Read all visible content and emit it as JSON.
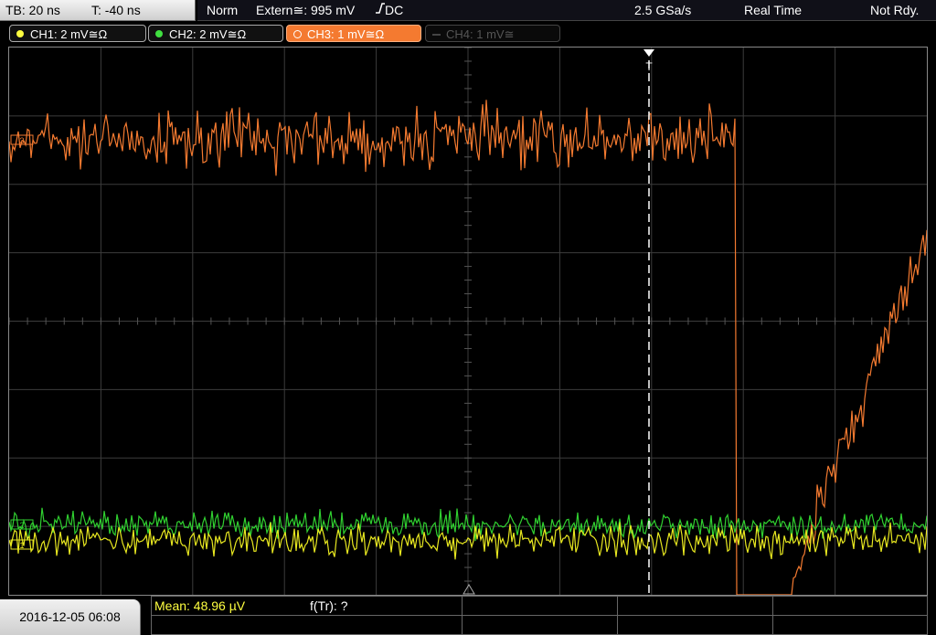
{
  "topbar": {
    "timebase": "TB: 20 ns",
    "trigger_time": "T: -40 ns",
    "mode": "Norm",
    "trigger_source": "Extern≅: 995 mV",
    "trigger_coupling": "DC",
    "sample_rate": "2.5 GSa/s",
    "acquisition": "Real Time",
    "status": "Not Rdy."
  },
  "channels": [
    {
      "label": "CH1: 2 mV≅Ω",
      "color": "#ffff40",
      "state": "on"
    },
    {
      "label": "CH2: 2 mV≅Ω",
      "color": "#40e040",
      "state": "on"
    },
    {
      "label": "CH3: 1 mV≅Ω",
      "color": "#f47a30",
      "state": "active"
    },
    {
      "label": "CH4: 1 mV≅",
      "color": "#606060",
      "state": "off"
    }
  ],
  "markers": {
    "ch1": "1",
    "ch2": "2",
    "ch3": "3",
    "trigger": "T"
  },
  "colors": {
    "ch1": "#e8e820",
    "ch2": "#30d030",
    "ch3": "#f47a30",
    "grid": "#3c3c3c"
  },
  "bottom": {
    "datetime": "2016-12-05 06:08",
    "mean": "Mean: 48.96 µV",
    "ftr": "f(Tr): ?"
  }
}
